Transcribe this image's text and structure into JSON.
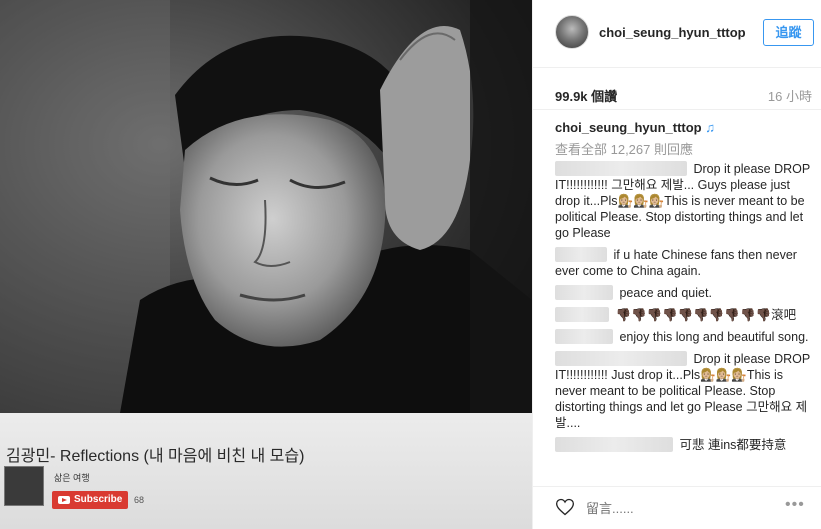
{
  "photo": {
    "song_title": "김광민- Reflections (내 마음에 비친 내 모습)",
    "channel_name": "삶은 여행",
    "subscribe_label": "Subscribe",
    "subscriber_count": "68"
  },
  "header": {
    "username": "choi_seung_hyun_tttop",
    "follow_label": "追蹤"
  },
  "stats": {
    "views": "99.9k 個讚",
    "time_ago": "16 小時"
  },
  "post": {
    "author": "choi_seung_hyun_tttop",
    "author_icon": "♫",
    "view_all": "查看全部 12,267 則回應"
  },
  "comments": [
    {
      "text": "Drop it please DROP IT!!!!!!!!!!!! 그만해요 제발... Guys please just drop it...Pls👩🏼‍⚖️👩🏼‍⚖️👩🏼‍⚖️This is never meant to be political Please. Stop distorting things and let go Please"
    },
    {
      "text": "if u hate Chinese fans then never ever come to China again."
    },
    {
      "text": "peace and quiet."
    },
    {
      "text": "👎🏿👎🏿👎🏿👎🏿👎🏿👎🏿👎🏿👎🏿👎🏿👎🏿滾吧"
    },
    {
      "text": "enjoy this long and beautiful song."
    },
    {
      "text": "Drop it please DROP IT!!!!!!!!!!!! Just drop it...Pls👩🏼‍⚖️👩🏼‍⚖️👩🏼‍⚖️This is never meant to be political Please. Stop distorting things and let go Please 그만해요 제발...."
    },
    {
      "text": "可悲 連ins都要持意"
    }
  ],
  "actions": {
    "heart_icon": "heart-outline-icon",
    "comment_placeholder": "留言......",
    "more_label": "•••"
  },
  "colors": {
    "accent": "#3897f0",
    "subscribe_red": "#d93a31",
    "muted": "#999999"
  }
}
